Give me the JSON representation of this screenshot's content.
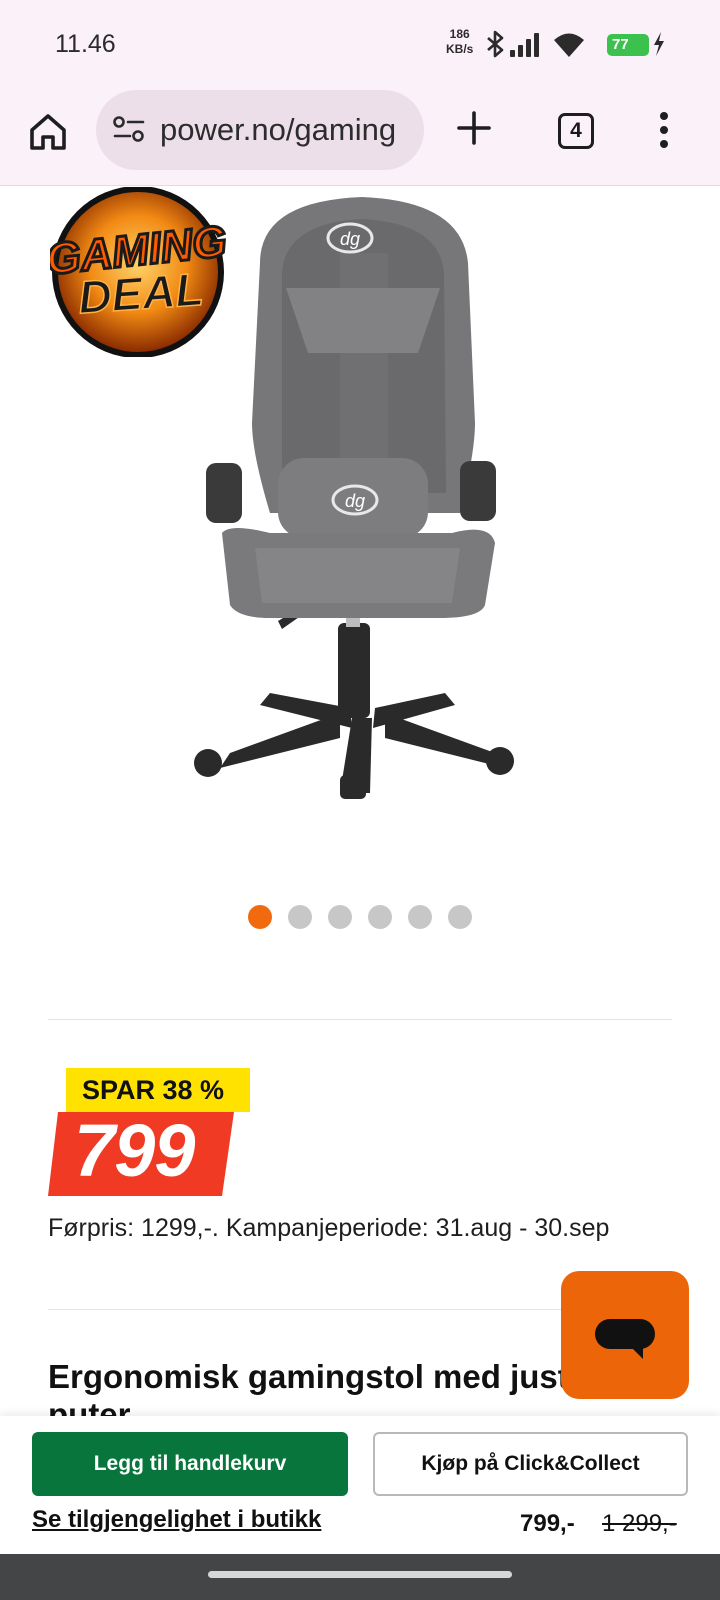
{
  "status_bar": {
    "time": "11.46",
    "net_speed_value": "186",
    "net_speed_unit": "KB/s",
    "battery": "77",
    "icons": [
      "bluetooth-icon",
      "signal-icon",
      "wifi-icon",
      "battery-icon",
      "charging-icon"
    ]
  },
  "browser": {
    "url": "power.no/gaming",
    "tab_count": "4"
  },
  "gallery": {
    "badge_line1": "GAMING",
    "badge_line2": "DEAL",
    "chair_logo": "dg",
    "slide_count": 6,
    "active_slide": 1
  },
  "pricing": {
    "discount": "SPAR 38 %",
    "price": "799",
    "previous_info": "Førpris: 1299,-. Kampanjeperiode: 31.aug - 30.sep"
  },
  "product": {
    "title_line1": "Ergonomisk gamingstol med just",
    "title_line2": "puter"
  },
  "bottom_bar": {
    "add_to_cart": "Legg til handlekurv",
    "click_collect": "Kjøp på Click&Collect",
    "availability": "Se tilgjengelighet i butikk",
    "price": "799,-",
    "old_price": "1 299,-"
  },
  "colors": {
    "accent_orange": "#f26a10",
    "chat_orange": "#ec6508",
    "cart_green": "#08753c",
    "spar_yellow": "#ffe200",
    "price_red": "#f03a24"
  }
}
